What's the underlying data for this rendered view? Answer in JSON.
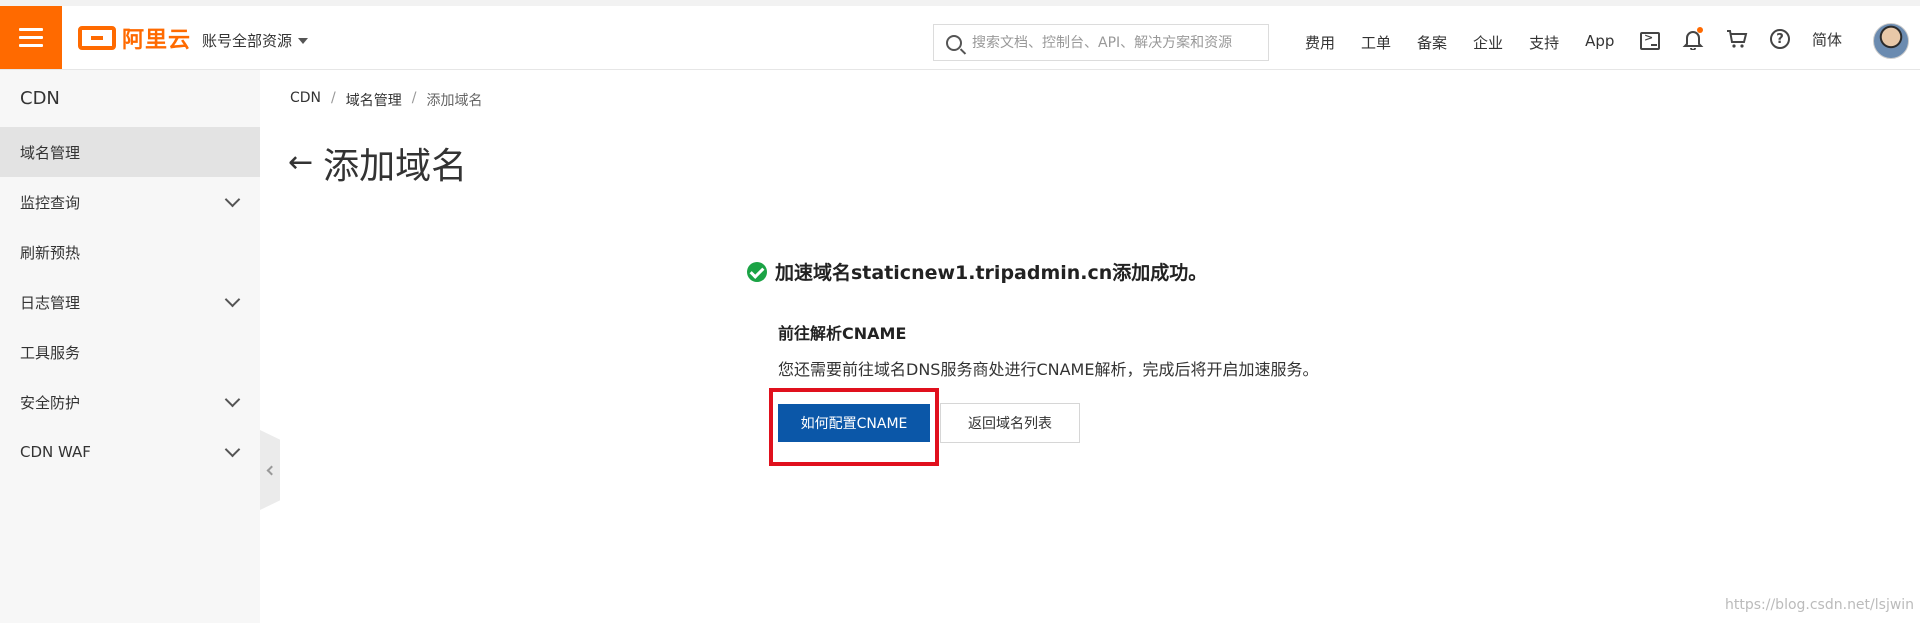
{
  "topbar": {
    "brand": "阿里云",
    "resources_label": "账号全部资源",
    "search_placeholder": "搜索文档、控制台、API、解决方案和资源",
    "links": [
      "费用",
      "工单",
      "备案",
      "企业",
      "支持",
      "App"
    ],
    "language": "简体",
    "icons": [
      "terminal-icon",
      "bell-icon",
      "cart-icon",
      "help-icon"
    ],
    "accent_color": "#ff6a00"
  },
  "sidebar": {
    "title": "CDN",
    "items": [
      {
        "label": "域名管理",
        "expandable": false,
        "active": true
      },
      {
        "label": "监控查询",
        "expandable": true,
        "active": false
      },
      {
        "label": "刷新预热",
        "expandable": false,
        "active": false
      },
      {
        "label": "日志管理",
        "expandable": true,
        "active": false
      },
      {
        "label": "工具服务",
        "expandable": false,
        "active": false
      },
      {
        "label": "安全防护",
        "expandable": true,
        "active": false
      },
      {
        "label": "CDN WAF",
        "expandable": true,
        "active": false
      }
    ]
  },
  "breadcrumb": [
    "CDN",
    "域名管理",
    "添加域名"
  ],
  "page": {
    "title": "添加域名",
    "success_message": "加速域名staticnew1.tripadmin.cn添加成功。",
    "guide_title": "前往解析CNAME",
    "guide_desc": "您还需要前往域名DNS服务商处进行CNAME解析，完成后将开启加速服务。",
    "primary_button": "如何配置CNAME",
    "secondary_button": "返回域名列表",
    "primary_color": "#0b57a8",
    "success_color": "#1ba345",
    "highlight_color": "#e0101d"
  },
  "watermark": "https://blog.csdn.net/lsjwin"
}
